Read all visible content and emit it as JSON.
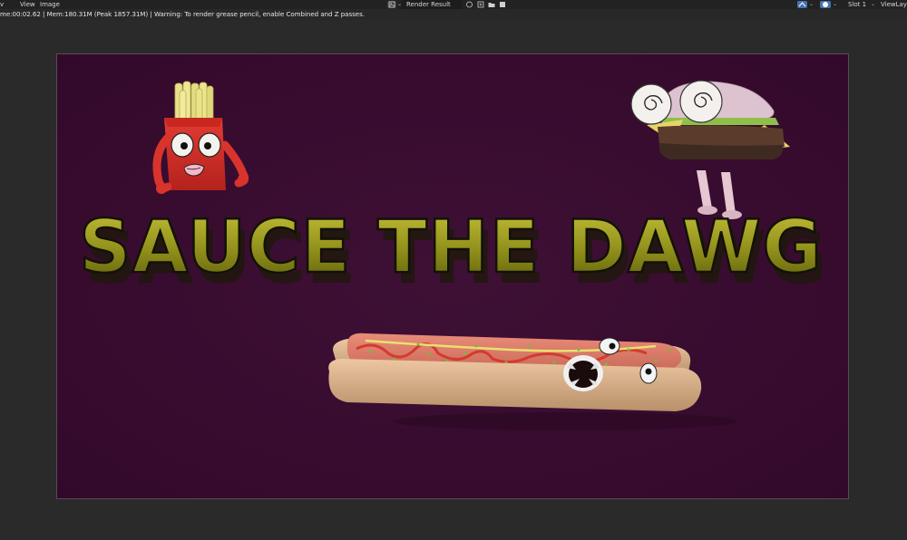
{
  "header": {
    "view_menu_prefix": "v",
    "view_label": "View",
    "image_label": "Image",
    "image_name": "Render Result",
    "slot": "Slot 1",
    "view_layer": "ViewLayer"
  },
  "status": {
    "text": "me:00:02.62 | Mem:180.31M (Peak 1857.31M) | Warning: To render grease pencil, enable Combined and Z passes."
  },
  "render": {
    "title": "SAUCE THE DAWG",
    "title_color": "#9a9a1e",
    "background": "#3a0f32"
  },
  "colors": {
    "ui_bg": "#282828",
    "header_bg": "#222222",
    "accent": "#4772b3"
  }
}
